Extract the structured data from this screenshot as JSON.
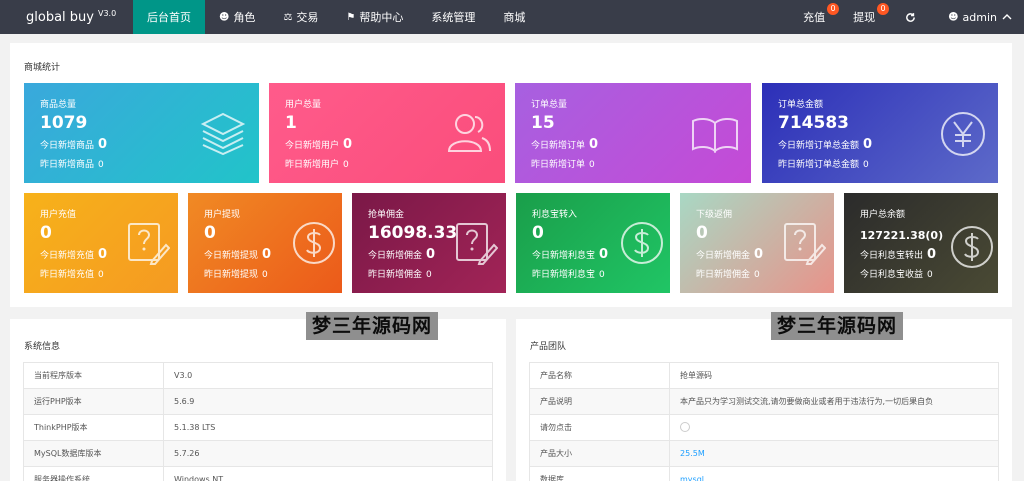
{
  "nav": {
    "logo": "global buy",
    "version": "V3.0",
    "items": [
      {
        "label": "后台首页",
        "icon": ""
      },
      {
        "label": "角色",
        "icon": "user-icon"
      },
      {
        "label": "交易",
        "icon": "scale-icon"
      },
      {
        "label": "帮助中心",
        "icon": "flag-icon"
      },
      {
        "label": "系统管理",
        "icon": ""
      },
      {
        "label": "商城",
        "icon": ""
      }
    ],
    "recharge_label": "充值",
    "recharge_count": "0",
    "withdraw_label": "提现",
    "withdraw_count": "0",
    "refresh_icon": "refresh-icon",
    "user_label": "admin",
    "colors": {
      "bar": "#393d49",
      "active": "#009688",
      "badge": "#ff5722"
    }
  },
  "stats": {
    "title": "商城统计",
    "top_cards": [
      {
        "label": "商品总量",
        "value": "1079",
        "today_label": "今日新增商品",
        "today": "0",
        "yesterday_label": "昨日新增商品",
        "yesterday": "0",
        "icon": "layers-icon"
      },
      {
        "label": "用户总量",
        "value": "1",
        "today_label": "今日新增用户",
        "today": "0",
        "yesterday_label": "昨日新增用户",
        "yesterday": "0",
        "icon": "users-icon"
      },
      {
        "label": "订单总量",
        "value": "15",
        "today_label": "今日新增订单",
        "today": "0",
        "yesterday_label": "昨日新增订单",
        "yesterday": "0",
        "icon": "book-icon"
      },
      {
        "label": "订单总金额",
        "value": "714583",
        "today_label": "今日新增订单总金额",
        "today": "0",
        "yesterday_label": "昨日新增订单总金额",
        "yesterday": "0",
        "icon": "yen-icon"
      }
    ],
    "bottom_cards": [
      {
        "label": "用户充值",
        "value": "0",
        "today_label": "今日新增充值",
        "today": "0",
        "yesterday_label": "昨日新增充值",
        "yesterday": "0",
        "icon": "question-edit-icon"
      },
      {
        "label": "用户提现",
        "value": "0",
        "today_label": "今日新增提现",
        "today": "0",
        "yesterday_label": "昨日新增提现",
        "yesterday": "0",
        "icon": "dollar-icon"
      },
      {
        "label": "抢单佣金",
        "value": "16098.33",
        "today_label": "今日新增佣金",
        "today": "0",
        "yesterday_label": "昨日新增佣金",
        "yesterday": "0",
        "icon": "question-edit-icon"
      },
      {
        "label": "利息宝转入",
        "value": "0",
        "today_label": "今日新增利息宝",
        "today": "0",
        "yesterday_label": "昨日新增利息宝",
        "yesterday": "0",
        "icon": "dollar-icon"
      },
      {
        "label": "下级返佣",
        "value": "0",
        "today_label": "今日新增佣金",
        "today": "0",
        "yesterday_label": "昨日新增佣金",
        "yesterday": "0",
        "icon": "question-edit-icon"
      },
      {
        "label": "用户总余额",
        "value": "127221.38(0)",
        "today_label": "今日利息宝转出",
        "today": "0",
        "yesterday_label": "今日利息宝收益",
        "yesterday": "0",
        "icon": "dollar-icon"
      }
    ]
  },
  "watermark": "梦三年源码网",
  "system_info": {
    "title": "系统信息",
    "rows": [
      {
        "k": "当前程序版本",
        "v": "V3.0"
      },
      {
        "k": "运行PHP版本",
        "v": "5.6.9"
      },
      {
        "k": "ThinkPHP版本",
        "v": "5.1.38 LTS"
      },
      {
        "k": "MySQL数据库版本",
        "v": "5.7.26"
      },
      {
        "k": "服务器操作系统",
        "v": "Windows NT"
      }
    ]
  },
  "product_team": {
    "title": "产品团队",
    "rows": [
      {
        "k": "产品名称",
        "v": "抢单源码"
      },
      {
        "k": "产品说明",
        "v": "本产品只为学习测试交流,请勿要做商业或者用于违法行为,一切后果自负"
      },
      {
        "k": "请勿点击",
        "v": ""
      },
      {
        "k": "产品大小",
        "v": "25.5M"
      },
      {
        "k": "数据库",
        "v": "mysql"
      }
    ]
  }
}
